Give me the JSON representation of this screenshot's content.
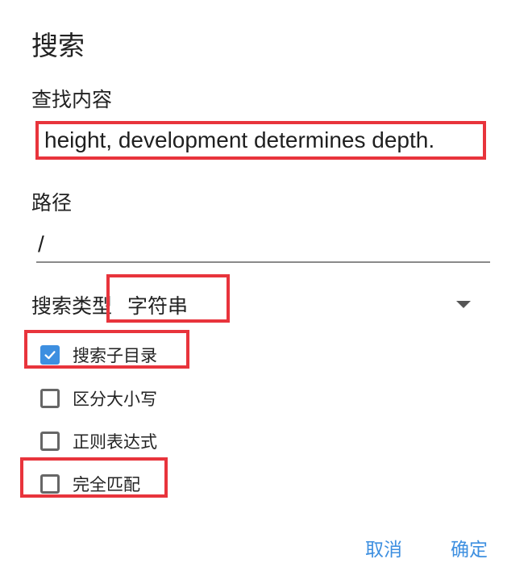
{
  "dialog": {
    "title": "搜索",
    "find_label": "查找内容",
    "find_value": "height,  development determines depth.",
    "path_label": "路径",
    "path_value": "/",
    "search_type_label": "搜索类型",
    "search_type_value": "字符串",
    "options": [
      {
        "label": "搜索子目录",
        "checked": true
      },
      {
        "label": "区分大小写",
        "checked": false
      },
      {
        "label": "正则表达式",
        "checked": false
      },
      {
        "label": "完全匹配",
        "checked": false
      }
    ],
    "cancel_label": "取消",
    "ok_label": "确定"
  },
  "colors": {
    "accent": "#3d8fe0",
    "highlight": "#e8343c"
  }
}
